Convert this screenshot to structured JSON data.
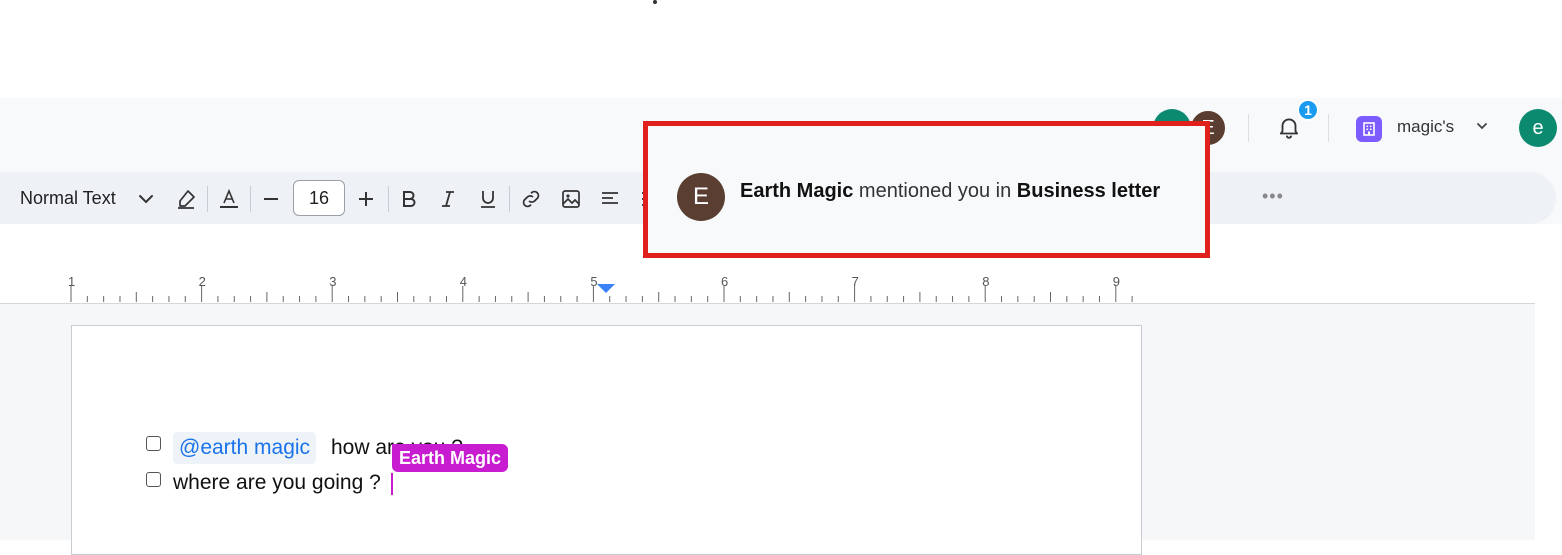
{
  "header": {
    "collaborators": [
      {
        "initial": "e",
        "color": "#0b8a6f"
      },
      {
        "initial": "E",
        "color": "#5a3e32"
      }
    ],
    "notifications": {
      "count": "1"
    },
    "workspace": {
      "name": "magic's"
    },
    "current_user": {
      "initial": "e"
    }
  },
  "toolbar": {
    "text_style": "Normal Text",
    "font_size": "16",
    "more": "•••"
  },
  "notification_popup": {
    "avatar_initial": "E",
    "actor": "Earth Magic",
    "message": " mentioned you in ",
    "document": "Business letter"
  },
  "ruler": {
    "numbers": [
      "1",
      "2",
      "3",
      "4",
      "5",
      "6",
      "7",
      "8",
      "9"
    ]
  },
  "document": {
    "line1": {
      "mention": "@earth magic",
      "text": "how are you ?"
    },
    "line2": {
      "text": "where are you going ?"
    },
    "collaborator_cursor": {
      "name": "Earth Magic",
      "color": "#c71ccf"
    }
  }
}
